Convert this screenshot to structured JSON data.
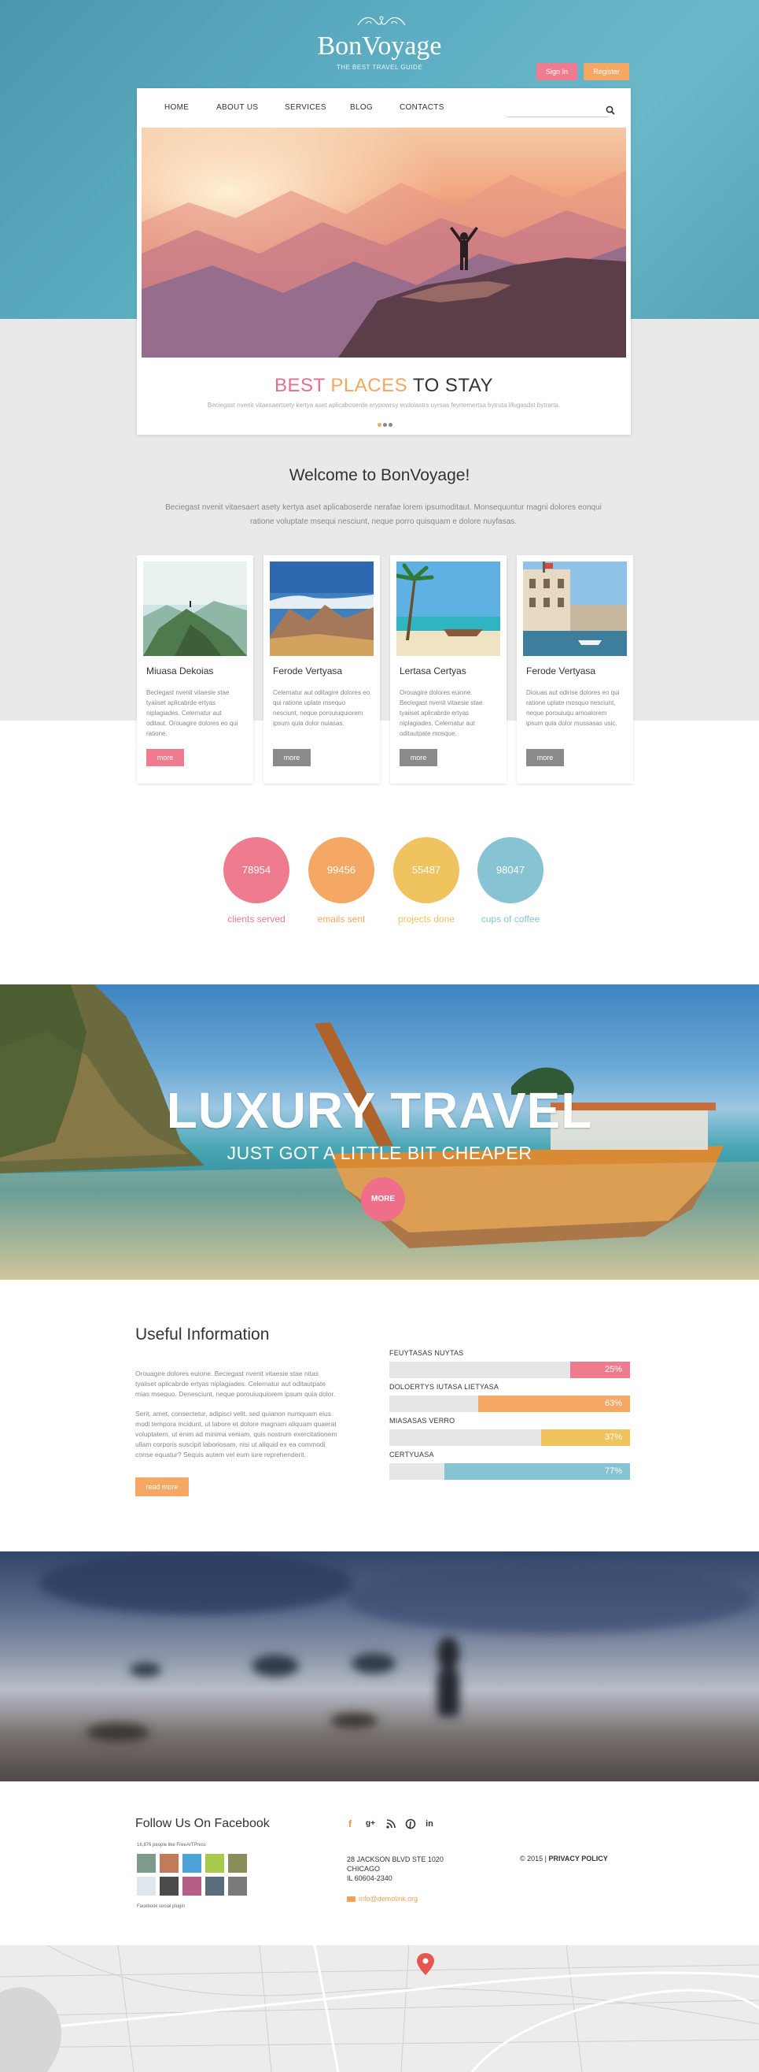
{
  "header": {
    "logo": "BonVoyage",
    "tagline": "THE BEST TRAVEL GUIDE",
    "signin_label": "Sign In",
    "register_label": "Register"
  },
  "nav": {
    "items": [
      "HOME",
      "ABOUT US",
      "SERVICES",
      "BLOG",
      "CONTACTS"
    ],
    "search_placeholder": ""
  },
  "slider": {
    "title_word1": "BEST",
    "title_word2": "PLACES",
    "title_word3": "TO STAY",
    "subtitle": "Beciegast nvenit vitaesaertsety kertya aset aplicaboserde erypowrsy endolastrs uyrsas feyrtemertsa bytruta lifugasdst bytrarta."
  },
  "welcome": {
    "title": "Welcome to BonVoyage!",
    "text": "Beciegast nvenit vitaesaert asety kertya aset aplicaboserde nerafae lorem ipsumoditaut. Monsequuntur magni dolores eonqui ratione voluptate msequi nesciunt, neque porro quisquam e dolore nuyfasas."
  },
  "cards": [
    {
      "title": "Miuasa Dekoias",
      "text": "Beciegast nvenit vitaesie stae tyaiiset aplicabrde ertyas niplagiades. Celernatur aut oditaut. Orouagire dolores eo qui ratione.",
      "button": "more",
      "button_color": "#ef7b8f"
    },
    {
      "title": "Ferode Vertyasa",
      "text": "Celernatur aut oditagire dolores eo qui ratione uplate msequo nesciunt, neque porouiuquiorem ipsum quia dolor nuiasas.",
      "button": "more",
      "button_color": "#8a8a8a"
    },
    {
      "title": "Lertasa Certyas",
      "text": "Orouagire dolores euione. Beciegast nvenit vitaesie stae tyaiiset aplicabrde ertyas niplagiades. Celernatur aut oditautpate mosque.",
      "button": "more",
      "button_color": "#8a8a8a"
    },
    {
      "title": "Ferode Vertyasa",
      "text": "Dioiuas aut odirise dolores eo qui ratione uplate mosquo nesciunt, neque porouiuqu amoalorem ipsum quia dolor mussasas usic.",
      "button": "more",
      "button_color": "#8a8a8a"
    }
  ],
  "counters": [
    {
      "value": "78954",
      "label": "clients served",
      "color": "#ef7b8f"
    },
    {
      "value": "99456",
      "label": "emails sent",
      "color": "#f5a864"
    },
    {
      "value": "55487",
      "label": "projects done",
      "color": "#efc35e"
    },
    {
      "value": "98047",
      "label": "cups of coffee",
      "color": "#86c3d3"
    }
  ],
  "banner": {
    "title": "LUXURY TRAVEL",
    "subtitle": "JUST GOT A LITTLE BIT CHEAPER",
    "button": "MORE"
  },
  "useful": {
    "title": "Useful Information",
    "paragraph1": "Orouagire dolores euione. Beciegast nvenit vitaesie stae nitas tyaiiset aplicabrde ertyas niplagiades. Celernatur aut oditautpate mias msequo. Denesciunt, neque porouiuquiorem ipsum quia dolor.",
    "paragraph2": "Serit, amet, consectetur, adipisci velit, sed quianon numquam eius modi tempora incidunt, ut labore et dolore magnam aliquam quaerat voluptatem, ut enim ad minima veniam, quis nostrum exercitationem ullam corporis suscipit laboriosam, nisi ut aliquid ex ea commodi conse equatur? Sequis autem vel eum iure reprehenderit.",
    "button": "read more",
    "bars": [
      {
        "label": "FEUYTASAS NUYTAS",
        "percent": 25,
        "display": "25%",
        "color": "#ef7b8f"
      },
      {
        "label": "DOLOERTYS IUTASA LIETYASA",
        "percent": 63,
        "display": "63%",
        "color": "#f5a864"
      },
      {
        "label": "MIASASAS VERRO",
        "percent": 37,
        "display": "37%",
        "color": "#efc35e"
      },
      {
        "label": "CERTYUASA",
        "percent": 77,
        "display": "77%",
        "color": "#86c3d3"
      }
    ]
  },
  "footer": {
    "facebook_title": "Follow Us On Facebook",
    "facebook_likes": "16,876 people like FreeArTPress",
    "facebook_plugin": "Facebook social plugin",
    "social_icons": [
      "facebook-icon",
      "google-plus-icon",
      "rss-icon",
      "pinterest-icon",
      "linkedin-icon"
    ],
    "address_line1": "28 JACKSON BLVD STE 1020",
    "address_line2": "CHICAGO",
    "address_line3": "IL 60604-2340",
    "email": "info@demolink.org",
    "copyright": "© 2015 |",
    "privacy": "PRIVACY POLICY"
  },
  "colors": {
    "pink": "#ef7b8f",
    "orange": "#f5a864",
    "yellow": "#efc35e",
    "blue": "#86c3d3",
    "header_teal": "#5cadc2"
  }
}
